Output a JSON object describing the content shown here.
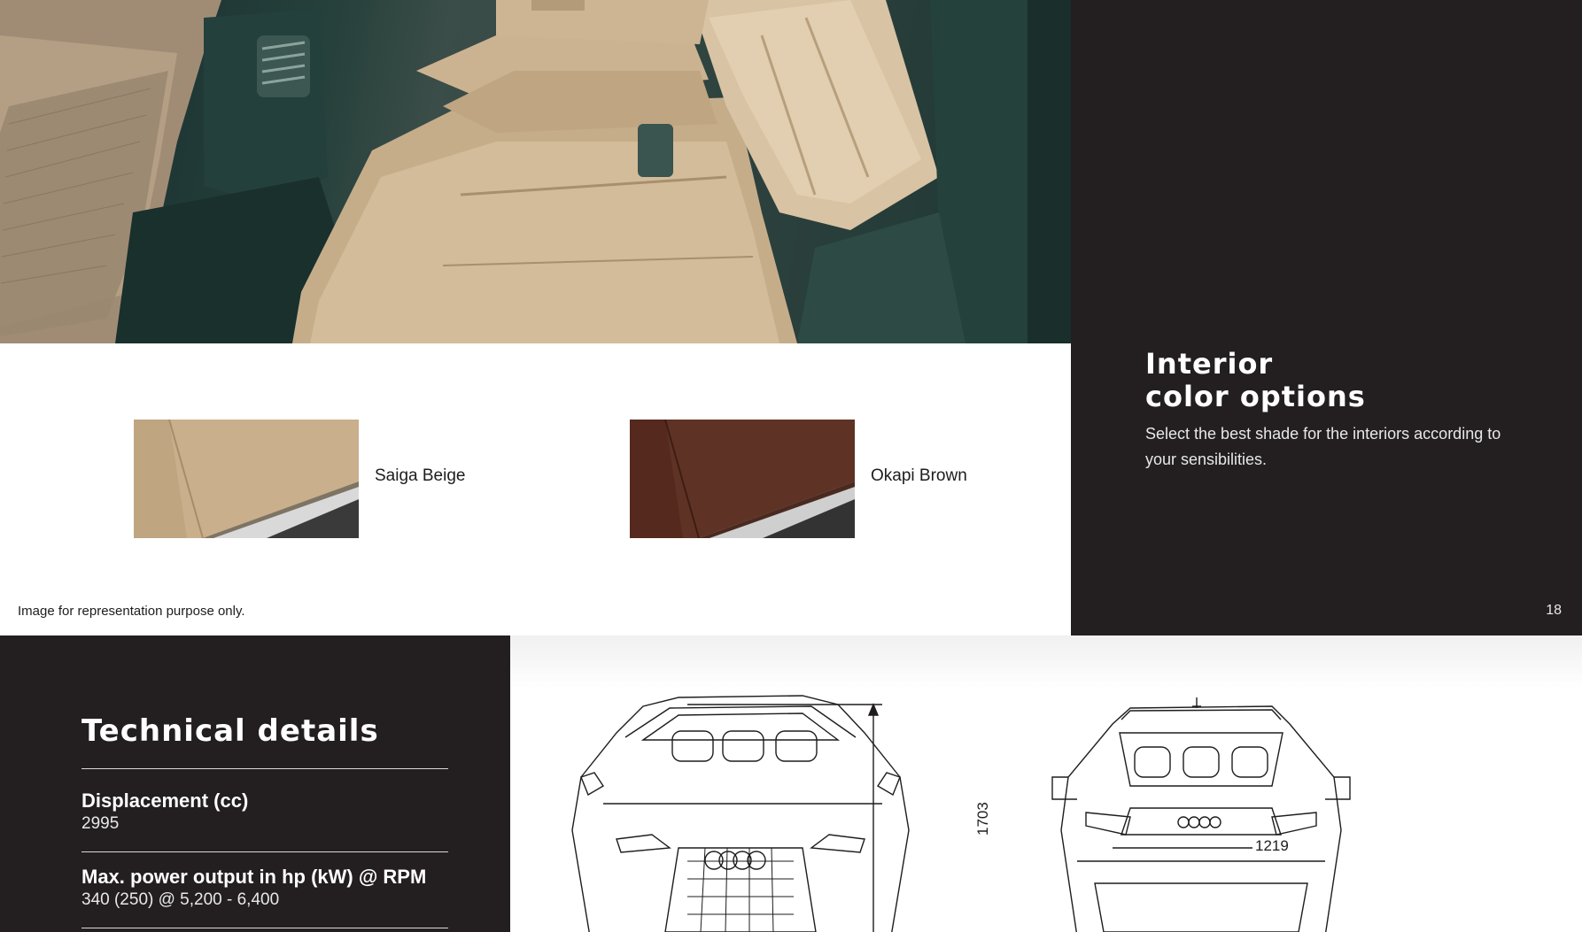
{
  "interior": {
    "title": "Interior\ncolor options",
    "description": "Select the best shade for the interiors according to your sensibilities.",
    "page_number": "18",
    "disclaimer": "Image for representation purpose only.",
    "swatches": [
      {
        "label": "Saiga Beige",
        "color": "#c9af8b"
      },
      {
        "label": "Okapi Brown",
        "color": "#5e3325"
      }
    ]
  },
  "technical": {
    "title": "Technical details",
    "specs": [
      {
        "label": "Displacement (cc)",
        "value": "2995"
      },
      {
        "label": "Max. power output in hp (kW) @ RPM",
        "value": "340 (250) @ 5,200 - 6,400"
      }
    ],
    "dimensions": {
      "height": "1703",
      "track_width": "1219"
    }
  },
  "colors": {
    "dark_panel": "#231f20",
    "seat_leather": "#c9b08e",
    "cabin_dark": "#1f3835"
  }
}
